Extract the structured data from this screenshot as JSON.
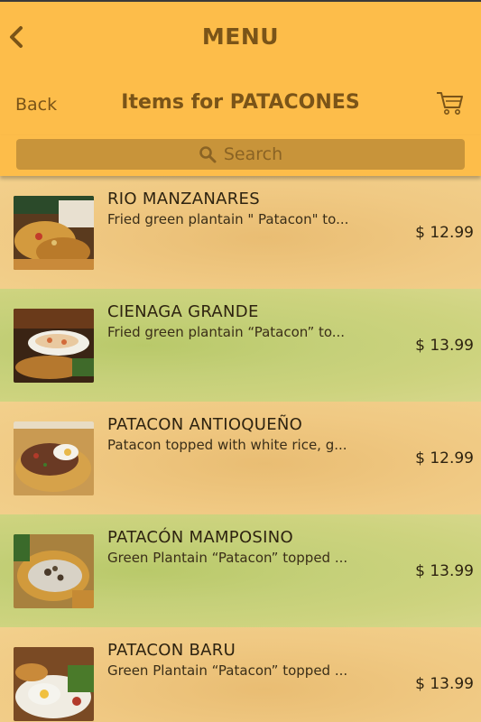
{
  "header": {
    "title": "MENU",
    "back_label": "Back",
    "section_title": "Items for PATACONES"
  },
  "search": {
    "placeholder": "Search"
  },
  "items": [
    {
      "name": "RIO MANZANARES",
      "description": "Fried green plantain \" Patacon\" to...",
      "price": "$ 12.99"
    },
    {
      "name": "CIENAGA GRANDE",
      "description": "Fried green plantain “Patacon” to...",
      "price": "$ 13.99"
    },
    {
      "name": "PATACON ANTIOQUEÑO",
      "description": "Patacon topped with white rice, g...",
      "price": "$ 12.99"
    },
    {
      "name": "PATACÓN MAMPOSINO",
      "description": "Green Plantain “Patacon” topped ...",
      "price": "$ 13.99"
    },
    {
      "name": "PATACON BARU",
      "description": "Green Plantain “Patacon” topped ...",
      "price": "$ 13.99"
    }
  ],
  "icons": {
    "back": "chevron-left-icon",
    "cart": "cart-icon",
    "search": "search-icon"
  },
  "colors": {
    "header_bg": "#fdbd4a",
    "header_text": "#7a5418",
    "search_bg": "#c8943a",
    "row_orange": "#f0c983",
    "row_green": "#c5d079"
  }
}
